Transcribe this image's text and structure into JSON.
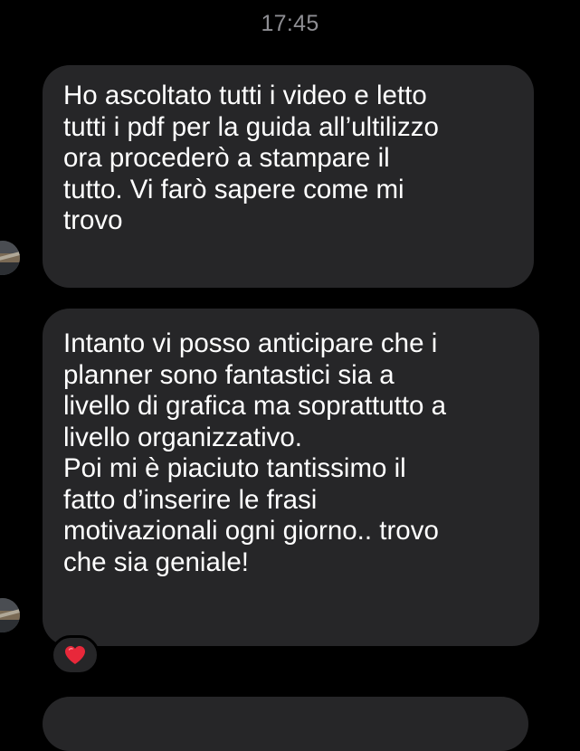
{
  "chat": {
    "timestamp": "17:45",
    "messages": [
      {
        "lines": [
          "Ho ascoltato tutti i video e letto",
          "tutti i pdf per la guida all’ultilizzo",
          "ora procederò a stampare il",
          "tutto. Vi farò sapere come mi",
          "trovo"
        ]
      },
      {
        "lines": [
          "Intanto vi posso anticipare che i",
          "planner sono fantastici sia a",
          "livello di grafica ma soprattutto a",
          "livello organizzativo.",
          "Poi mi è piaciuto tantissimo il",
          "fatto d’inserire le frasi",
          "motivazionali ogni giorno.. trovo",
          "che sia geniale!"
        ],
        "reaction": "heart-icon"
      }
    ]
  },
  "colors": {
    "background": "#000000",
    "bubble": "#262628",
    "text": "#ffffff",
    "timestamp": "#8e8e93",
    "heart": "#e8283a"
  }
}
